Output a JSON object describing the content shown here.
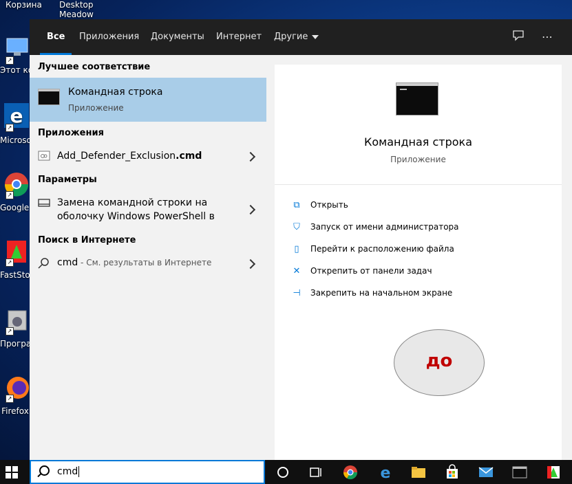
{
  "desktop": {
    "top_labels": [
      "Корзина",
      "Desktop",
      "Meadow"
    ],
    "icons": [
      {
        "name": "this-pc",
        "label": "Этот компь"
      },
      {
        "name": "edge",
        "label": "Microsoft Edge"
      },
      {
        "name": "chrome",
        "label": "Google Chrome"
      },
      {
        "name": "faststone",
        "label": "FastStone Capture"
      },
      {
        "name": "programs",
        "label": "Программы и компо"
      },
      {
        "name": "firefox",
        "label": "Firefox"
      }
    ]
  },
  "tabs": [
    {
      "label": "Все",
      "active": true
    },
    {
      "label": "Приложения"
    },
    {
      "label": "Документы"
    },
    {
      "label": "Интернет"
    },
    {
      "label": "Другие"
    }
  ],
  "left": {
    "best_match_title": "Лучшее соответствие",
    "best_match": {
      "title": "Командная строка",
      "subtitle": "Приложение"
    },
    "apps_title": "Приложения",
    "app_item": {
      "name": "Add_Defender_Exclusion",
      "ext": ".cmd"
    },
    "settings_title": "Параметры",
    "settings_item": {
      "line1": "Замена командной строки на",
      "line2": "оболочку Windows PowerShell в"
    },
    "web_title": "Поиск в Интернете",
    "web_item": {
      "query": "cmd",
      "hint": " - См. результаты в Интернете"
    }
  },
  "right": {
    "title": "Командная строка",
    "subtitle": "Приложение",
    "actions": [
      {
        "label": "Открыть",
        "icon": "open-icon"
      },
      {
        "label": "Запуск от имени администратора",
        "icon": "shield-admin-icon"
      },
      {
        "label": "Перейти к расположению файла",
        "icon": "file-location-icon"
      },
      {
        "label": "Открепить от панели задач",
        "icon": "unpin-icon"
      },
      {
        "label": "Закрепить на начальном экране",
        "icon": "pin-icon"
      }
    ],
    "annotation": "до"
  },
  "search": {
    "value": "cmd"
  },
  "colors": {
    "accent": "#0078d7",
    "selection": "#a9cde8",
    "annotation": "#c00000"
  }
}
